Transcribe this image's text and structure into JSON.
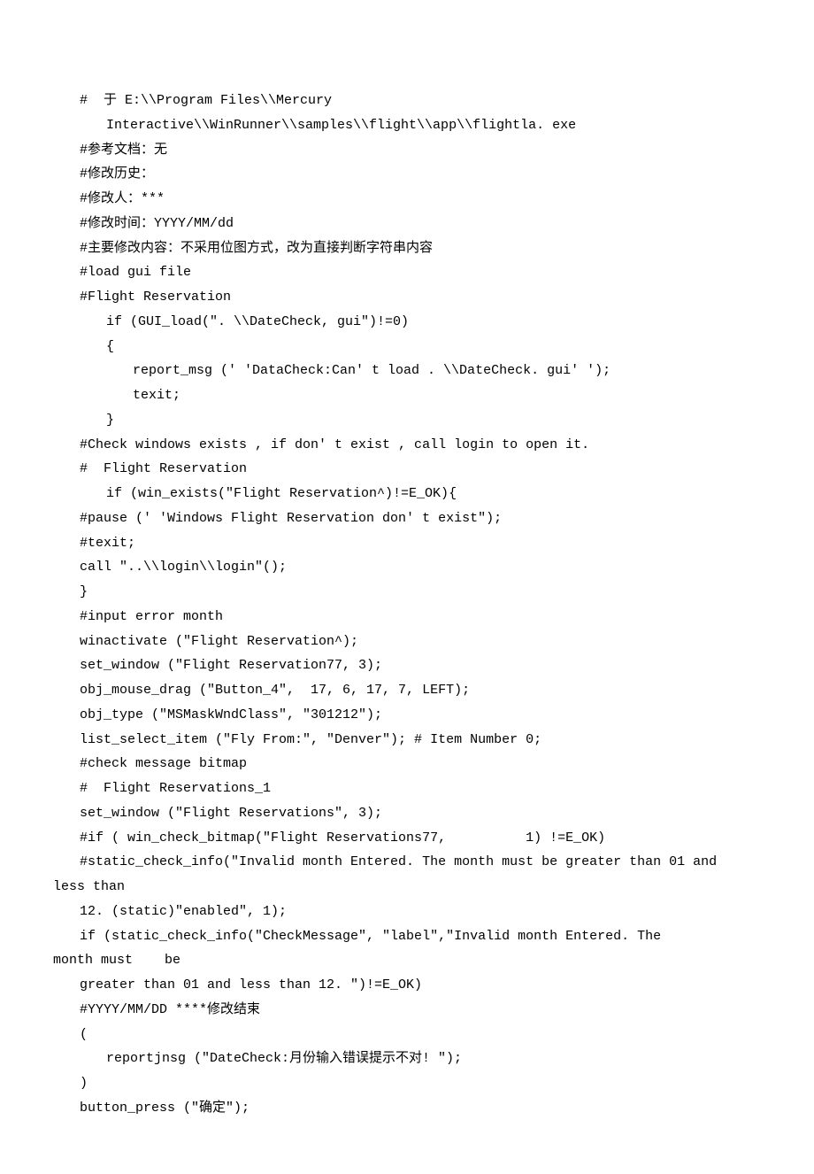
{
  "lines": [
    {
      "cls": "code-line",
      "text": "#  于 E:\\\\Program Files\\\\Mercury"
    },
    {
      "cls": "code-line indent1",
      "text": "Interactive\\\\WinRunner\\\\samples\\\\flight\\\\app\\\\flightla. exe"
    },
    {
      "cls": "code-line",
      "text": "#参考文档：无"
    },
    {
      "cls": "code-line",
      "text": "#修改历史："
    },
    {
      "cls": "code-line",
      "text": "#修改人：***"
    },
    {
      "cls": "code-line",
      "text": "#修改时间：YYYY/MM/dd"
    },
    {
      "cls": "code-line",
      "text": "#主要修改内容：不采用位图方式，改为直接判断字符串内容"
    },
    {
      "cls": "code-line",
      "text": "#load gui file"
    },
    {
      "cls": "code-line",
      "text": "#Flight Reservation"
    },
    {
      "cls": "code-line indent1",
      "text": "if (GUI_load(\". \\\\DateCheck, gui\")!=0)"
    },
    {
      "cls": "code-line indent1",
      "text": "{"
    },
    {
      "cls": "code-line indent2",
      "text": "report_msg (' 'DataCheck:Can' t load . \\\\DateCheck. gui' ');"
    },
    {
      "cls": "code-line indent2",
      "text": "texit;"
    },
    {
      "cls": "code-line indent1",
      "text": "}"
    },
    {
      "cls": "code-line",
      "text": "#Check windows exists , if don' t exist , call login to open it."
    },
    {
      "cls": "code-line",
      "text": "#  Flight Reservation"
    },
    {
      "cls": "code-line indent1",
      "text": "if (win_exists(\"Flight Reservation^)!=E_OK){"
    },
    {
      "cls": "code-line",
      "text": "#pause (' 'Windows Flight Reservation don' t exist\");"
    },
    {
      "cls": "code-line",
      "text": "#texit;"
    },
    {
      "cls": "code-line",
      "text": "call \"..\\\\login\\\\login\"();"
    },
    {
      "cls": "code-line",
      "text": "}"
    },
    {
      "cls": "code-line",
      "text": "#input error month"
    },
    {
      "cls": "code-line",
      "text": "winactivate (\"Flight Reservation^);"
    },
    {
      "cls": "code-line",
      "text": "set_window (\"Flight Reservation77, 3);"
    },
    {
      "cls": "code-line",
      "text": "obj_mouse_drag (\"Button_4\",  17, 6, 17, 7, LEFT);"
    },
    {
      "cls": "code-line",
      "text": "obj_type (\"MSMaskWndClass\", \"301212\");"
    },
    {
      "cls": "code-line",
      "text": "list_select_item (\"Fly From:\", \"Denver\"); # Item Number 0;"
    },
    {
      "cls": "code-line",
      "text": "#check message bitmap"
    },
    {
      "cls": "code-line",
      "text": "#  Flight Reservations_1"
    },
    {
      "cls": "code-line",
      "text": "set_window (\"Flight Reservations\", 3);"
    },
    {
      "cls": "code-line",
      "text": ""
    },
    {
      "cls": "code-line",
      "text": "#if ( win_check_bitmap(\"Flight Reservations77,          1) !=E_OK)"
    },
    {
      "cls": "code-line",
      "text": "#static_check_info(\"Invalid month Entered. The month must be greater than 01 and"
    },
    {
      "cls": "code-line no-indent",
      "text": "less than"
    },
    {
      "cls": "code-line",
      "text": "12. (static)\"enabled\", 1);"
    },
    {
      "cls": "code-line",
      "text": "if (static_check_info(\"CheckMessage\", \"label\",\"Invalid month Entered. The"
    },
    {
      "cls": "code-line no-indent",
      "text": "month must    be"
    },
    {
      "cls": "code-line",
      "text": "greater than 01 and less than 12. \")!=E_OK)"
    },
    {
      "cls": "code-line",
      "text": "#YYYY/MM/DD ****修改结束"
    },
    {
      "cls": "code-line",
      "text": "("
    },
    {
      "cls": "code-line indent1",
      "text": "reportjnsg (\"DateCheck:月份输入错误提示不对! \");"
    },
    {
      "cls": "code-line",
      "text": ")"
    },
    {
      "cls": "code-line",
      "text": "button_press (\"确定\");"
    }
  ]
}
